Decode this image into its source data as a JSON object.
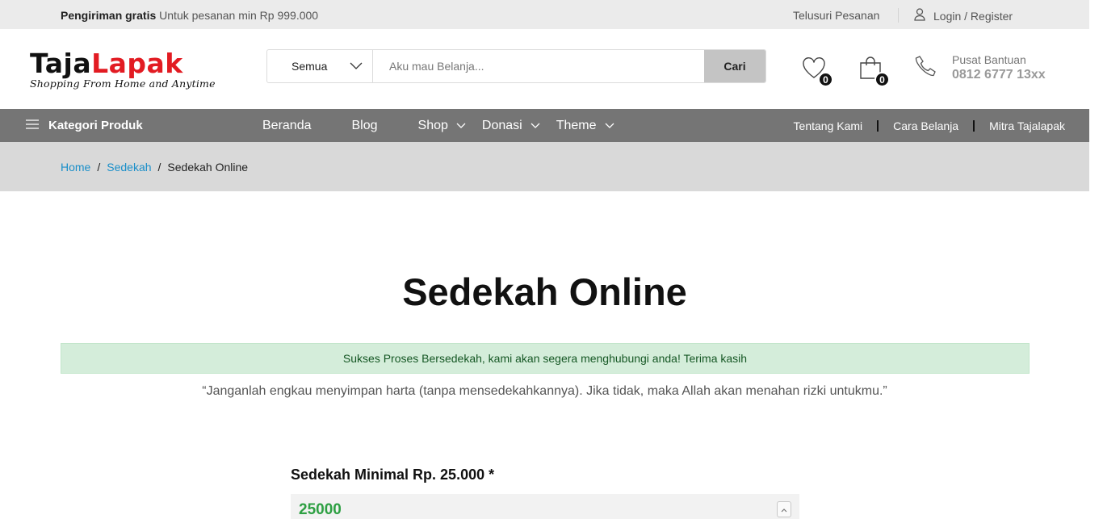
{
  "topbar": {
    "promo_bold": "Pengiriman gratis",
    "promo_text": "Untuk pesanan min Rp 999.000",
    "track_order": "Telusuri Pesanan",
    "login_register": "Login / Register"
  },
  "header": {
    "logo_main_1": "Taja",
    "logo_main_2": "Lapak",
    "logo_tagline": "Shopping From Home and Anytime",
    "search_category": "Semua",
    "search_placeholder": "Aku mau Belanja...",
    "search_button": "Cari",
    "wishlist_count": "0",
    "cart_count": "0",
    "help_label": "Pusat Bantuan",
    "help_phone": "0812 6777 13xx"
  },
  "nav": {
    "categories_label": "Kategori Produk",
    "menu": [
      {
        "label": "Beranda"
      },
      {
        "label": "Blog"
      },
      {
        "label": "Shop"
      },
      {
        "label": "Donasi"
      },
      {
        "label": "Theme"
      }
    ],
    "right": [
      {
        "label": "Tentang Kami"
      },
      {
        "label": "Cara Belanja"
      },
      {
        "label": "Mitra Tajalapak"
      }
    ]
  },
  "breadcrumb": {
    "home": "Home",
    "parent": "Sedekah",
    "separator": "/",
    "current": "Sedekah Online"
  },
  "content": {
    "title": "Sedekah Online",
    "notice": "Sukses Proses Bersedekah, kami akan segera menghubungi anda! Terima kasih",
    "quote": "“Janganlah engkau menyimpan harta (tanpa mensedekahkannya). Jika tidak, maka Allah akan menahan rizki untukmu.”",
    "amount_label": "Sedekah Minimal Rp. 25.000 *",
    "amount_value": "25000"
  },
  "colors": {
    "logo_accent": "#e21b22",
    "nav_bg": "#757575",
    "link": "#1a8fc9",
    "notice_bg": "#d4edda",
    "amount_text": "#2ea043"
  }
}
